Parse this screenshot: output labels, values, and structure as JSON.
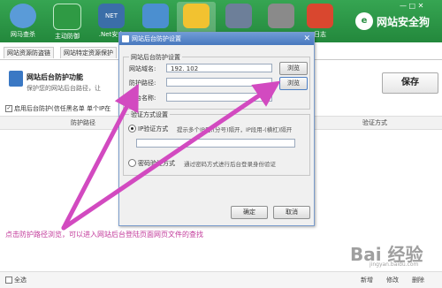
{
  "toolbar": {
    "items": [
      {
        "label": "网马查杀",
        "icon": "globe-scan-icon",
        "color": "#5a9bd8"
      },
      {
        "label": "主动防御",
        "icon": "shield-icon",
        "color": "#2f9a44"
      },
      {
        "label": ".Net安全",
        "icon": "net-icon",
        "color": "#3b6ea8"
      },
      {
        "label": "",
        "icon": "chart-monitor-icon",
        "color": "#4b8fd0"
      },
      {
        "label": "",
        "icon": "folder-icon",
        "color": "#f2c230"
      },
      {
        "label": "",
        "icon": "rocket-icon",
        "color": "#6d7f99"
      },
      {
        "label": "",
        "icon": "router-icon",
        "color": "#8a8a8a"
      },
      {
        "label": "日志",
        "icon": "log-icon",
        "color": "#d9472f"
      }
    ],
    "brand": "网站安全狗",
    "window_controls": "— □ ✕"
  },
  "tabs": [
    "网站资源防盗链",
    "网站特定资源保护"
  ],
  "feature": {
    "title": "网站后台防护功能",
    "description": "保护您的网站后台路径，让",
    "save_label": "保存",
    "enable_label": "启用后台防护(信任黑名单 单个IP在",
    "enabled": true
  },
  "table": {
    "columns": [
      "防护路径",
      "验证方式"
    ]
  },
  "dialog": {
    "title": "网站后台防护设置",
    "close_label": "✕",
    "group1_title": "网站后台防护设置",
    "domain_label": "网站域名:",
    "domain_value": "192.        102",
    "path_label": "防护路径:",
    "path_value": "",
    "name_label": "后台名称:",
    "name_value": "",
    "browse_label": "浏览",
    "group2_title": "验证方式设置",
    "ip_option": "IP验证方式",
    "ip_hint": "提示多个IP用,(分号)隔开，IP段用-(横杠)隔开",
    "ip_value": "",
    "pwd_option": "密码验证方式",
    "pwd_hint": "通过密码方式进行后台登录身份验证",
    "selected": "ip",
    "ok_label": "确定",
    "cancel_label": "取消"
  },
  "annotation": {
    "text": "点击防护路径浏览，可以进入网站后台登陆页面网页文件的查找",
    "color": "#c2399a"
  },
  "bottombar": {
    "select_all": "全选",
    "new": "新增",
    "edit": "修改",
    "delete": "删除"
  },
  "watermark": {
    "text": "Bai 经验",
    "sub": "jingyan.baidu.com"
  }
}
